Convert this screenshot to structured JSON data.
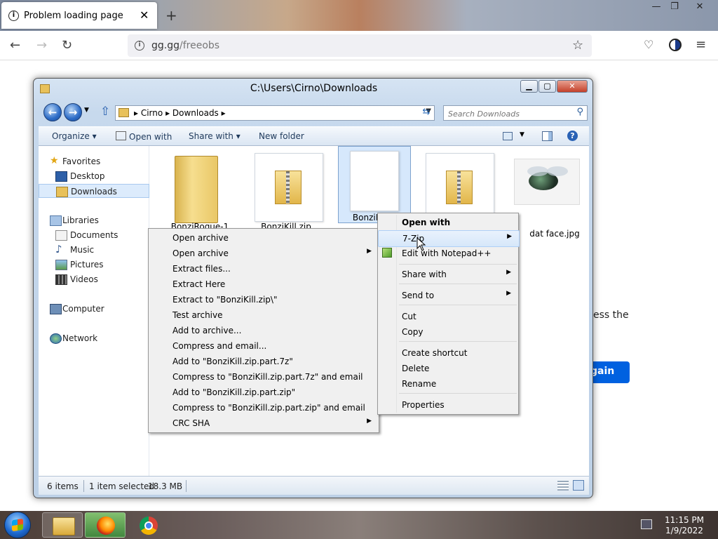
{
  "browser": {
    "tab_title": "Problem loading page",
    "tab_close": "✕",
    "new_tab": "+",
    "url_host": "gg.gg",
    "url_path": "/freeobs",
    "window_controls": {
      "minimize": "—",
      "restore": "❐",
      "close": "✕"
    }
  },
  "page": {
    "body_text_fragment": "ess the",
    "button_text_fragment": "gain"
  },
  "explorer": {
    "title": "C:\\Users\\Cirno\\Downloads",
    "breadcrumb": [
      "Cirno",
      "Downloads"
    ],
    "search_placeholder": "Search Downloads",
    "toolbar": {
      "organize": "Organize",
      "open_with": "Open with",
      "share_with": "Share with",
      "new_folder": "New folder"
    },
    "nav": {
      "favorites": "Favorites",
      "desktop": "Desktop",
      "downloads": "Downloads",
      "libraries": "Libraries",
      "documents": "Documents",
      "music": "Music",
      "pictures": "Pictures",
      "videos": "Videos",
      "computer": "Computer",
      "network": "Network"
    },
    "files": [
      {
        "name": "BonziRogue-1",
        "type": "folder"
      },
      {
        "name": "BonziKill.zip",
        "type": "zip"
      },
      {
        "name": "BonziKill.zi",
        "type": "selected-file"
      },
      {
        "name": "",
        "type": "zip"
      },
      {
        "name": "dat face.jpg",
        "type": "image"
      }
    ],
    "status": {
      "item_count": "6 items",
      "selection": "1 item selected",
      "size": "18.3 MB"
    }
  },
  "context_menu": {
    "open_with": "Open with",
    "seven_zip": "7-Zip",
    "edit_npp": "Edit with Notepad++",
    "share_with": "Share with",
    "send_to": "Send to",
    "cut": "Cut",
    "copy": "Copy",
    "create_shortcut": "Create shortcut",
    "delete": "Delete",
    "rename": "Rename",
    "properties": "Properties"
  },
  "seven_zip_menu": {
    "open_archive": "Open archive",
    "open_archive_sub": "Open archive",
    "extract_files": "Extract files...",
    "extract_here": "Extract Here",
    "extract_to": "Extract to \"BonziKill.zip\\\"",
    "test_archive": "Test archive",
    "add_to_archive": "Add to archive...",
    "compress_email": "Compress and email...",
    "add_to_7z": "Add to \"BonziKill.zip.part.7z\"",
    "compress_7z_email": "Compress to \"BonziKill.zip.part.7z\" and email",
    "add_to_zip": "Add to \"BonziKill.zip.part.zip\"",
    "compress_zip_email": "Compress to \"BonziKill.zip.part.zip\" and email",
    "crc_sha": "CRC SHA"
  },
  "taskbar": {
    "time": "11:15 PM",
    "date": "1/9/2022"
  }
}
